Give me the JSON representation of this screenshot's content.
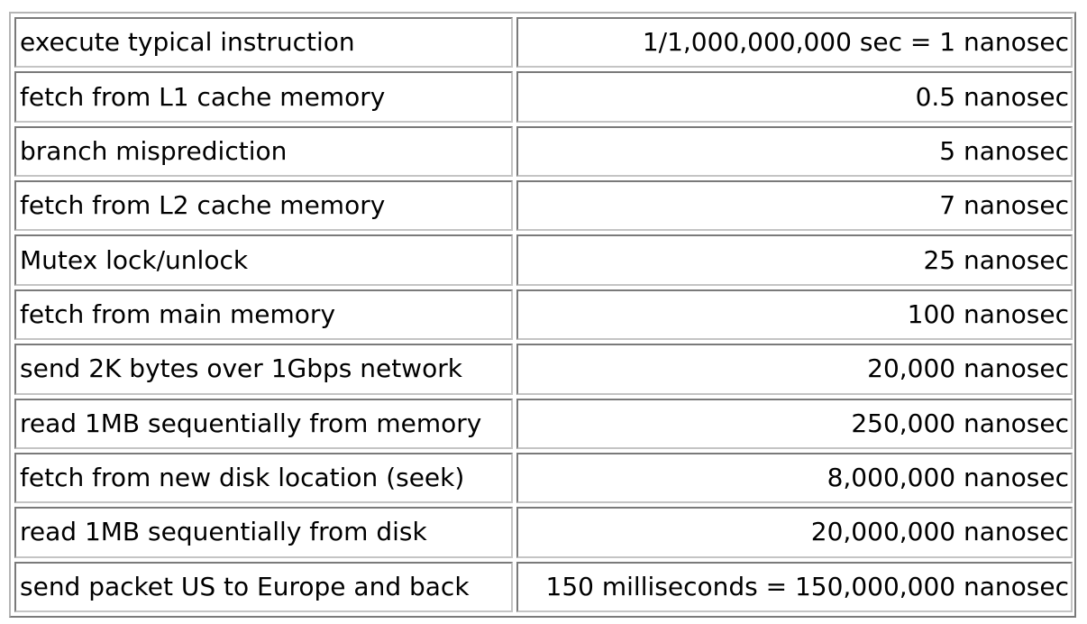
{
  "rows": [
    {
      "operation": "execute typical instruction",
      "time": "1/1,000,000,000 sec = 1 nanosec"
    },
    {
      "operation": "fetch from L1 cache memory",
      "time": "0.5 nanosec"
    },
    {
      "operation": "branch misprediction",
      "time": "5 nanosec"
    },
    {
      "operation": "fetch from L2 cache memory",
      "time": "7 nanosec"
    },
    {
      "operation": "Mutex lock/unlock",
      "time": "25 nanosec"
    },
    {
      "operation": "fetch from main memory",
      "time": "100 nanosec"
    },
    {
      "operation": "send 2K bytes over 1Gbps network",
      "time": "20,000 nanosec"
    },
    {
      "operation": "read 1MB sequentially from memory",
      "time": "250,000 nanosec"
    },
    {
      "operation": "fetch from new disk location (seek)",
      "time": "8,000,000 nanosec"
    },
    {
      "operation": "read 1MB sequentially from disk",
      "time": "20,000,000 nanosec"
    },
    {
      "operation": "send packet US to Europe and back",
      "time": "150 milliseconds = 150,000,000 nanosec"
    }
  ]
}
